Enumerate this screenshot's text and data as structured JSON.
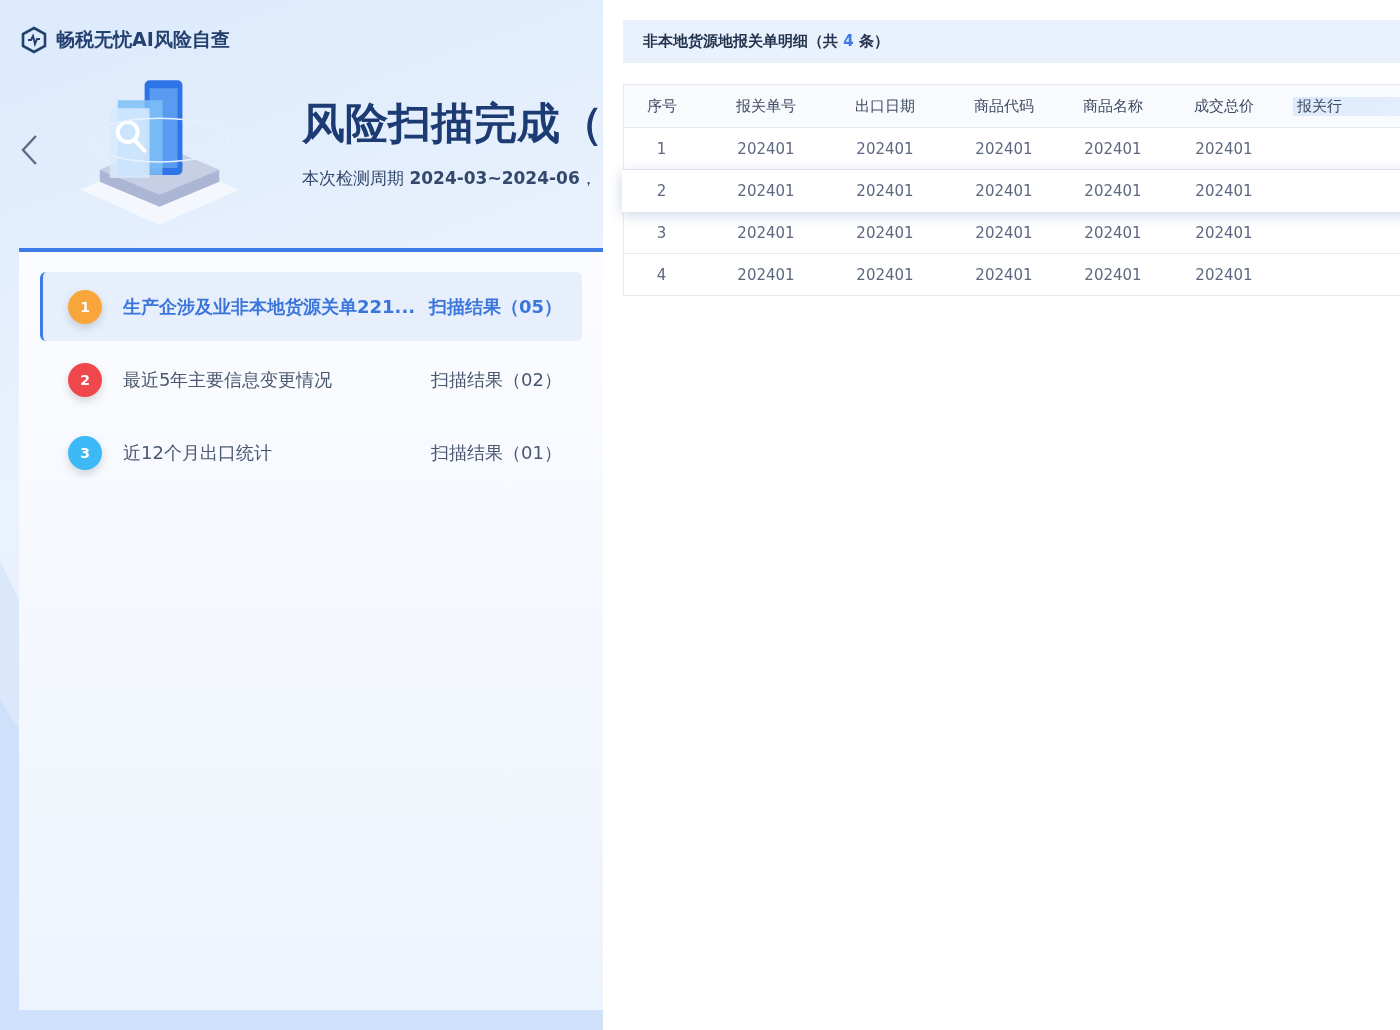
{
  "app": {
    "name": "畅税无忧AI风险自查"
  },
  "hero": {
    "title": "风险扫描完成（",
    "subtitle": "本次检测周期 **2024-03~2024-06**，"
  },
  "scan_items": [
    {
      "number": "1",
      "color": "#f8a63b",
      "title": "生产企涉及业非本地货源关单221...",
      "result": "扫描结果（05）",
      "selected": true
    },
    {
      "number": "2",
      "color": "#f0474c",
      "title": "最近5年主要信息变更情况",
      "result": "扫描结果（02）",
      "selected": false
    },
    {
      "number": "3",
      "color": "#3cb9f6",
      "title": "近12个月出口统计",
      "result": "扫描结果（01）",
      "selected": false
    }
  ],
  "detail": {
    "title_prefix": "非本地货源地报关单明细（共",
    "count": "4",
    "title_suffix": "条）",
    "table": {
      "columns": [
        "序号",
        "报关单号",
        "出口日期",
        "商品代码",
        "商品名称",
        "成交总价",
        "报关行"
      ],
      "rows": [
        {
          "selected": false,
          "cells": [
            "1",
            "202401",
            "202401",
            "202401",
            "202401",
            "202401"
          ]
        },
        {
          "selected": true,
          "cells": [
            "2",
            "202401",
            "202401",
            "202401",
            "202401",
            "202401"
          ]
        },
        {
          "selected": false,
          "cells": [
            "3",
            "202401",
            "202401",
            "202401",
            "202401",
            "202401"
          ]
        },
        {
          "selected": false,
          "cells": [
            "4",
            "202401",
            "202401",
            "202401",
            "202401",
            "202401"
          ]
        }
      ]
    }
  }
}
